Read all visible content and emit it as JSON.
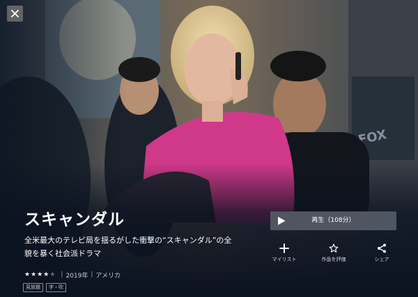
{
  "title": "スキャンダル",
  "description": "全米最大のテレビ局を揺るがした衝撃の“スキャンダル”の全貌を暴く社会派ドラマ",
  "rating": {
    "value": 4,
    "max": 5
  },
  "year": "2019年",
  "country": "アメリカ",
  "tags": [
    "見放題",
    "字・吹"
  ],
  "play": {
    "label": "再生",
    "duration": "（108分）"
  },
  "actions": {
    "mylist": "マイリスト",
    "rate": "作品を評価",
    "share": "シェア"
  },
  "colors": {
    "accent_play": "#4f5561",
    "background": "#0b1220",
    "pink_jacket": "#d0398a"
  },
  "icons": [
    "close-icon",
    "play-icon",
    "plus-icon",
    "star-outline-icon",
    "share-icon"
  ]
}
